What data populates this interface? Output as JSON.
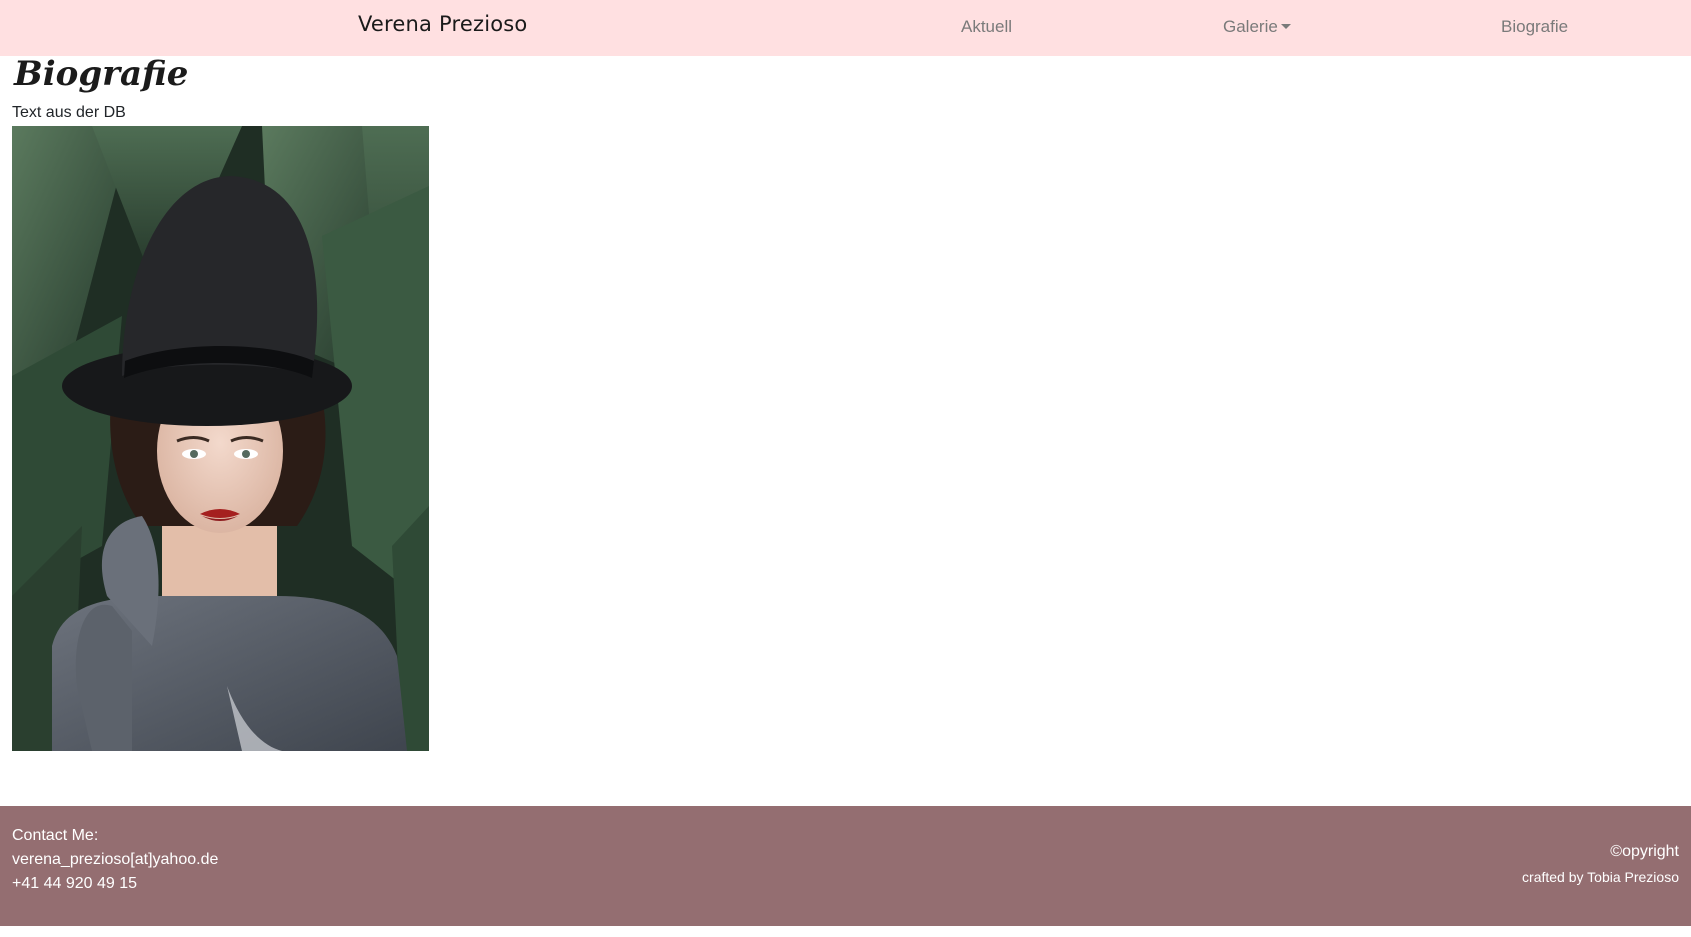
{
  "navbar": {
    "brand": "Verena Prezioso",
    "links": [
      {
        "label": "Aktuell"
      },
      {
        "label": "Galerie"
      },
      {
        "label": "Biografie"
      }
    ]
  },
  "main": {
    "title": "Biografie",
    "text": "Text aus der DB"
  },
  "footer": {
    "contact_heading": "Contact Me:",
    "email": "verena_prezioso[at]yahoo.de",
    "phone": "+41 44 920 49 15",
    "copyright": "©opyright",
    "crafted": "crafted by Tobia Prezioso"
  },
  "colors": {
    "navbar_bg": "#ffe0e1",
    "footer_bg": "#946e71",
    "nav_link": "#7a7a7a"
  }
}
